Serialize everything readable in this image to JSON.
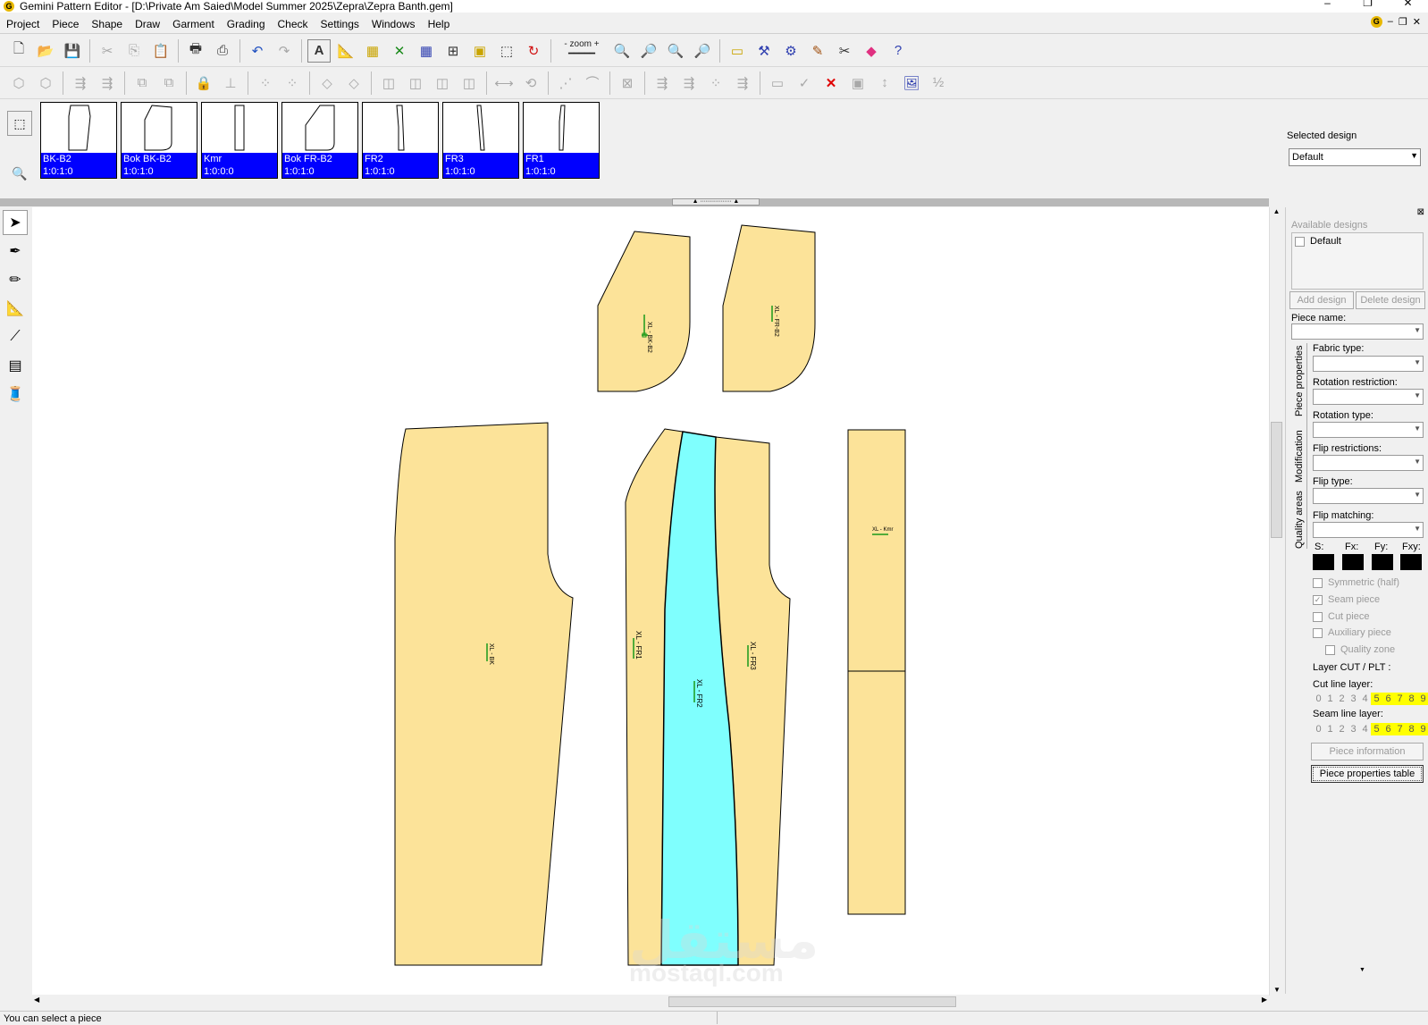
{
  "window": {
    "title": "Gemini Pattern Editor - [D:\\Private Am Saied\\Model Summer 2025\\Zepra\\Zepra Banth.gem]",
    "logo": "G",
    "controls": [
      "–",
      "❐",
      "✕"
    ]
  },
  "menu": {
    "items": [
      "Project",
      "Piece",
      "Shape",
      "Draw",
      "Garment",
      "Grading",
      "Check",
      "Settings",
      "Windows",
      "Help"
    ],
    "right_controls": [
      "G",
      "–",
      "❐",
      "✕"
    ]
  },
  "toolbar1": {
    "zoom_label": "zoom",
    "zoom_minus": "-",
    "zoom_plus": "+",
    "icons": [
      "new-icon",
      "open-icon",
      "save-icon",
      "cut-icon",
      "copy-icon",
      "paste-icon",
      "print-icon",
      "plot-icon",
      "undo-icon",
      "redo-icon",
      "text-icon",
      "measure-icon",
      "grade-icon",
      "intersect-icon",
      "grid-icon",
      "fit-icon",
      "piece-select-icon",
      "select-arrow-icon",
      "refresh-icon",
      "zoom-in-icon",
      "zoom-out-icon",
      "zoom-area-icon",
      "zoom-all-icon",
      "tool-a-icon",
      "tool-b-icon",
      "tool-c-icon",
      "tool-d-icon",
      "tool-e-icon",
      "color-icon",
      "help-icon"
    ]
  },
  "pieces": [
    {
      "name": "BK-B2",
      "size": "1:0:1:0"
    },
    {
      "name": "Bok BK-B2",
      "size": "1:0:1:0"
    },
    {
      "name": "Kmr",
      "size": "1:0:0:0"
    },
    {
      "name": "Bok FR-B2",
      "size": "1:0:1:0"
    },
    {
      "name": "FR2",
      "size": "1:0:1:0"
    },
    {
      "name": "FR3",
      "size": "1:0:1:0"
    },
    {
      "name": "FR1",
      "size": "1:0:1:0"
    }
  ],
  "selected_design": {
    "label": "Selected design",
    "value": "Default"
  },
  "canvas_labels": {
    "fr1": "XL - FR1",
    "fr2": "XL - FR2",
    "fr3": "XL - FR3",
    "bk": "XL - BK",
    "bok_bk": "XL - BK-B2",
    "bok_fr": "XL - FR-B2",
    "kmr": "XL - Kmr"
  },
  "watermark": {
    "arabic": "مستقل",
    "latin": "mostaql.com"
  },
  "right_panel": {
    "available_designs": "Available designs",
    "design_item": "Default",
    "add_design": "Add design",
    "delete_design": "Delete design",
    "piece_name": "Piece name:",
    "tabs": [
      "Piece properties",
      "Modification",
      "Quality areas"
    ],
    "fields": [
      "Fabric type:",
      "Rotation restriction:",
      "Rotation type:",
      "Flip restrictions:",
      "Flip type:",
      "Flip matching:"
    ],
    "flip_labels": [
      "S:",
      "Fx:",
      "Fy:",
      "Fxy:"
    ],
    "checkboxes": [
      {
        "label": "Symmetric (half)",
        "checked": false
      },
      {
        "label": "Seam piece",
        "checked": true
      },
      {
        "label": "Cut piece",
        "checked": false
      },
      {
        "label": "Auxiliary piece",
        "checked": false
      },
      {
        "label": "Quality zone",
        "checked": false
      }
    ],
    "layer_title": "Layer CUT / PLT :",
    "cut_line_layer": "Cut line layer:",
    "seam_line_layer": "Seam line layer:",
    "layers": [
      "0",
      "1",
      "2",
      "3",
      "4",
      "5",
      "6",
      "7",
      "8",
      "9"
    ],
    "piece_information": "Piece information",
    "piece_properties_table": "Piece properties table"
  },
  "status": "You can select a piece",
  "colors": {
    "piece_fill": "#fce399",
    "selected_fill": "#7ffffe",
    "label_blue": "#0000ff",
    "layer_highlight": "#ffff00"
  }
}
